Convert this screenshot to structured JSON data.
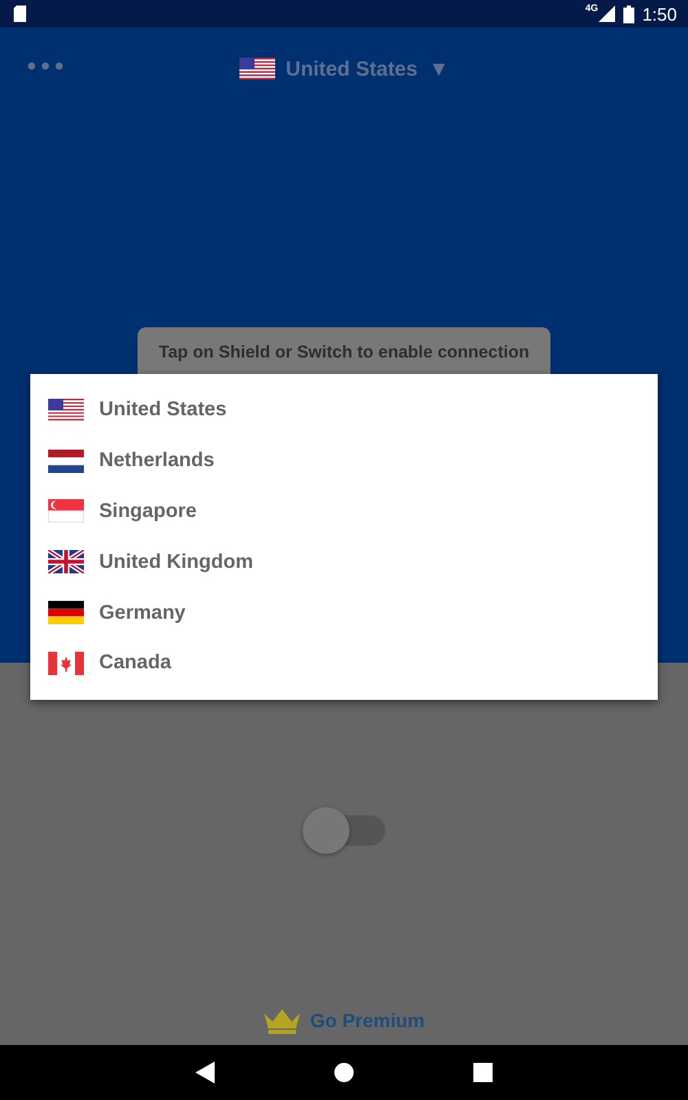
{
  "status_bar": {
    "network": "4G",
    "time": "1:50"
  },
  "header": {
    "country": {
      "label": "United States",
      "kind": "us"
    },
    "caret": "▼"
  },
  "tooltip": {
    "lines": [
      "Tap on Shield or Switch to enable connection"
    ]
  },
  "country_menu": {
    "items": [
      {
        "label": "United States",
        "kind": "us"
      },
      {
        "label": "Netherlands",
        "kind": "nl"
      },
      {
        "label": "Singapore",
        "kind": "sg"
      },
      {
        "label": "United Kingdom",
        "kind": "gb"
      },
      {
        "label": "Germany",
        "kind": "de"
      },
      {
        "label": "Canada",
        "kind": "ca"
      }
    ]
  },
  "switch": {
    "on": false
  },
  "premium": {
    "label": "Go Premium"
  }
}
